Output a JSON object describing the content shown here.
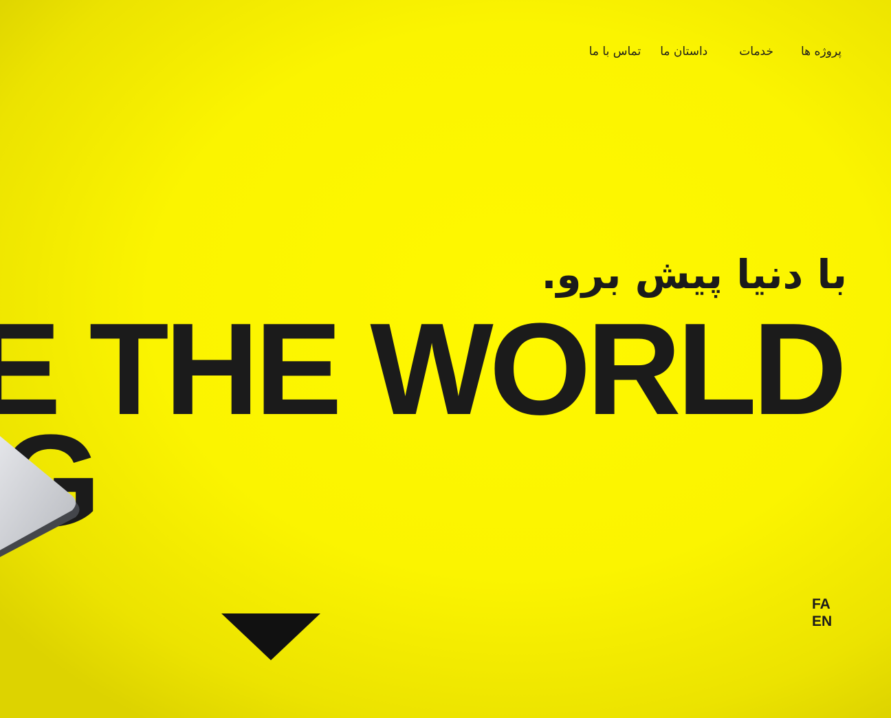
{
  "nav": {
    "items": [
      {
        "label": "پروژه ها"
      },
      {
        "label": "خدمات"
      },
      {
        "label": "داستان ما"
      },
      {
        "label": "تماس با ما"
      }
    ]
  },
  "hero": {
    "headline_fa": "با دنیا پیش برو.",
    "headline_en_line1": "RE THE WORLD",
    "headline_en_line2": "NG"
  },
  "language": {
    "options": [
      "FA",
      "EN"
    ],
    "selected": "FA"
  },
  "icons": {
    "scroll_down": "triangle-down-icon",
    "device": "laptop-image"
  },
  "colors": {
    "background": "#fff800",
    "text": "#1b1b1b"
  }
}
